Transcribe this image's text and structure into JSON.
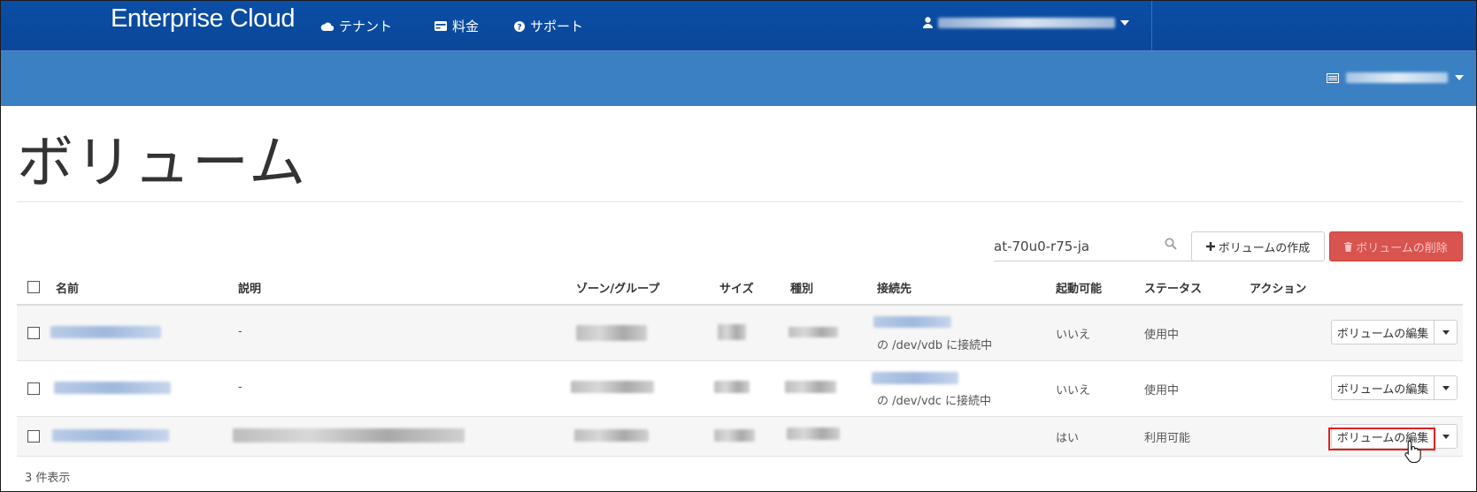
{
  "header": {
    "brand": "Enterprise Cloud",
    "nav": [
      {
        "label": "テナント",
        "icon": "cloud-icon"
      },
      {
        "label": "料金",
        "icon": "credit-card-icon"
      },
      {
        "label": "サポート",
        "icon": "question-icon"
      }
    ],
    "user_icon": "user-icon"
  },
  "subbar": {
    "tenant_icon": "server-icon"
  },
  "page": {
    "title": "ボリューム"
  },
  "toolbar": {
    "search_value": "at-70u0-r75-ja",
    "create_label": "ボリュームの作成",
    "delete_label": "ボリュームの削除"
  },
  "table": {
    "columns": [
      "名前",
      "説明",
      "ゾーン/グループ",
      "サイズ",
      "種別",
      "接続先",
      "起動可能",
      "ステータス",
      "アクション"
    ],
    "rows": [
      {
        "description": "-",
        "attached": "の /dev/vdb に接続中",
        "bootable": "いいえ",
        "status": "使用中",
        "action": "ボリュームの編集"
      },
      {
        "description": "-",
        "attached": "の /dev/vdc に接続中",
        "bootable": "いいえ",
        "status": "使用中",
        "action": "ボリュームの編集"
      },
      {
        "description": "",
        "attached": "",
        "bootable": "はい",
        "status": "利用可能",
        "action": "ボリュームの編集"
      }
    ]
  },
  "footer": {
    "count_text": "3 件表示"
  },
  "colors": {
    "navbar": "#0b4ea6",
    "subbar": "#3a80c3",
    "danger": "#d9534f",
    "highlight": "#e02020"
  }
}
